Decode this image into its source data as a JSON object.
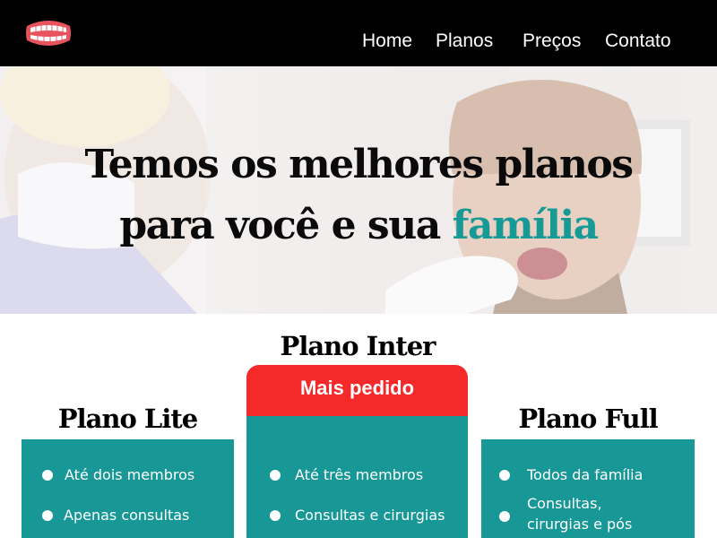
{
  "nav": {
    "items": [
      {
        "label": "Home"
      },
      {
        "label": "Planos"
      },
      {
        "label": "Preços"
      },
      {
        "label": "Contato"
      }
    ]
  },
  "hero": {
    "line1": "Temos os melhores planos",
    "line2_prefix": "para você e sua ",
    "line2_accent": "família"
  },
  "plans": [
    {
      "title": "Plano Lite",
      "features": [
        "Até dois membros",
        "Apenas consultas"
      ]
    },
    {
      "title": "Plano Inter",
      "badge": "Mais pedido",
      "features": [
        "Até três membros",
        "Consultas e cirurgias"
      ]
    },
    {
      "title": "Plano Full",
      "features": [
        "Todos da família",
        "Consultas,",
        "cirurgias e pós"
      ]
    }
  ],
  "colors": {
    "header_bg": "#000000",
    "accent_teal": "#179795",
    "badge_red": "#f42a2a"
  },
  "icons": {
    "logo": "teeth-icon"
  }
}
